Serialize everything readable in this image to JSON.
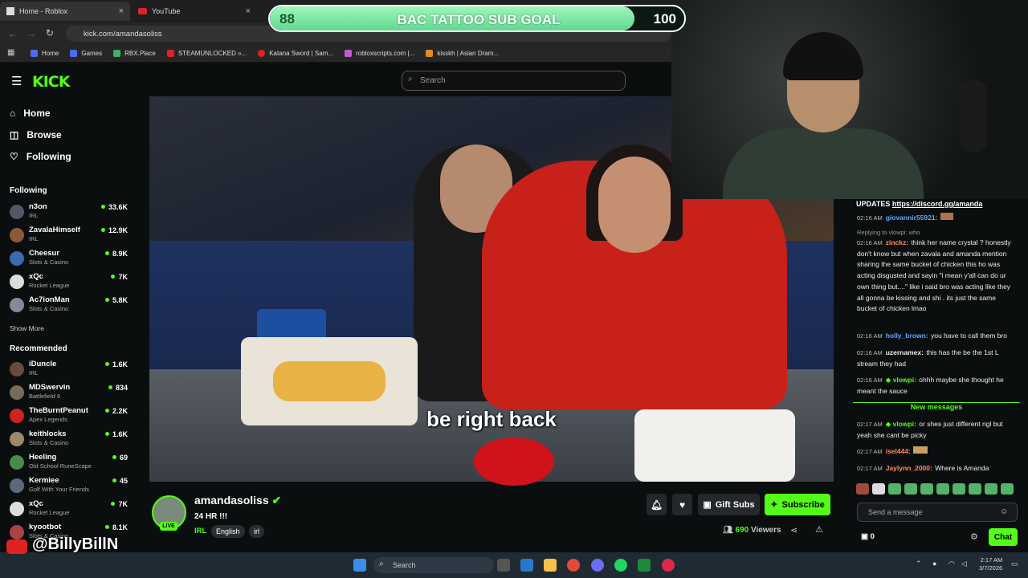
{
  "browser": {
    "tabs": [
      {
        "label": "Home - Roblox"
      },
      {
        "label": "YouTube"
      }
    ],
    "url": "kick.com/amandasoliss",
    "bookmarks": [
      "Home",
      "Games",
      "RBX.Place",
      "STEAMUNLOCKED »...",
      "Katana Sword | Sam...",
      "robloxscripts.com |...",
      "kisskh | Asian Dram..."
    ]
  },
  "goal": {
    "current": "88",
    "title": "BAC TATTOO SUB GOAL",
    "target": "100",
    "progress": 0.88
  },
  "kick": {
    "search_placeholder": "Search",
    "nav": [
      {
        "label": "Home"
      },
      {
        "label": "Browse"
      },
      {
        "label": "Following"
      }
    ],
    "following_title": "Following",
    "following": [
      {
        "name": "n3on",
        "category": "IRL",
        "viewers": "33.6K"
      },
      {
        "name": "ZavalaHimself",
        "category": "IRL",
        "viewers": "12.9K"
      },
      {
        "name": "Cheesur",
        "category": "Slots & Casino",
        "viewers": "8.9K"
      },
      {
        "name": "xQc",
        "category": "Rocket League",
        "viewers": "7K"
      },
      {
        "name": "Ac7ionMan",
        "category": "Slots & Casino",
        "viewers": "5.8K"
      }
    ],
    "show_more": "Show More",
    "recommended_title": "Recommended",
    "recommended": [
      {
        "name": "iDuncle",
        "category": "IRL",
        "viewers": "1.6K"
      },
      {
        "name": "MDSwervin",
        "category": "Battlefield 6",
        "viewers": "834"
      },
      {
        "name": "TheBurntPeanut",
        "category": "Apex Legends",
        "viewers": "2.2K"
      },
      {
        "name": "keithlocks",
        "category": "Slots & Casino",
        "viewers": "1.6K"
      },
      {
        "name": "Heeling",
        "category": "Old School RuneScape",
        "viewers": "69"
      },
      {
        "name": "Kermiee",
        "category": "Golf With Your Friends",
        "viewers": "45"
      },
      {
        "name": "xQc",
        "category": "Rocket League",
        "viewers": "7K"
      },
      {
        "name": "kyootbot",
        "category": "Slots & Casino",
        "viewers": "8.1K"
      }
    ]
  },
  "video": {
    "caption": "be right back"
  },
  "streamer": {
    "name": "amandasoliss",
    "live": "LIVE",
    "title": "24 HR !!!",
    "category": "IRL",
    "tags": [
      "English",
      "irl"
    ],
    "gift_label": "Gift Subs",
    "subscribe_label": "Subscribe",
    "viewers": "690",
    "viewers_label": "Viewers"
  },
  "chat": {
    "updates_label": "UPDATES",
    "updates_link": "https://discord.gg/amanda",
    "messages": [
      {
        "time": "02:16 AM",
        "user": "giovannir55921:",
        "color": "#5fa8ff",
        "text": ""
      },
      {
        "time": "",
        "user": "",
        "color": "#999",
        "text": "Replying to vlowpi: who"
      },
      {
        "time": "02:16 AM",
        "user": "zinckz:",
        "color": "#ff8c5a",
        "text": "think her name crystal ? honestly don't know but when zavala and amanda mention sharing the same bucket of chicken this ho was acting disgusted and sayin \"i mean y'all can do ur own thing but....\" like i said bro was acting like they all gonna be kissing and shi . its just the same bucket of chicken lmao"
      },
      {
        "time": "02:16 AM",
        "user": "holly_brown:",
        "color": "#5fa8ff",
        "text": "you have to call them bro"
      },
      {
        "time": "02:16 AM",
        "user": "uzernamex:",
        "color": "#e0e0e0",
        "text": "this has the be the 1st L stream they had"
      },
      {
        "time": "02:16 AM",
        "user": "vlowpi:",
        "color": "#53fc18",
        "text": "ohhh maybe she thought he meant the sauce"
      },
      {
        "time": "02:17 AM",
        "user": "vlowpi:",
        "color": "#53fc18",
        "text": "or shes just different ngl but yeah she cant be picky"
      },
      {
        "time": "02:17 AM",
        "user": "isel444:",
        "color": "#ff8c5a",
        "text": ""
      },
      {
        "time": "02:17 AM",
        "user": "Jaylynn_2000:",
        "color": "#ff8c5a",
        "text": "Where is Amanda"
      }
    ],
    "new_messages": "New messages",
    "input_placeholder": "Send a message",
    "user_count": "0",
    "send_label": "Chat"
  },
  "taskbar": {
    "search": "Search",
    "time": "2:17 AM",
    "date": "3/7/2026"
  },
  "watermark": "@BillyBillN"
}
